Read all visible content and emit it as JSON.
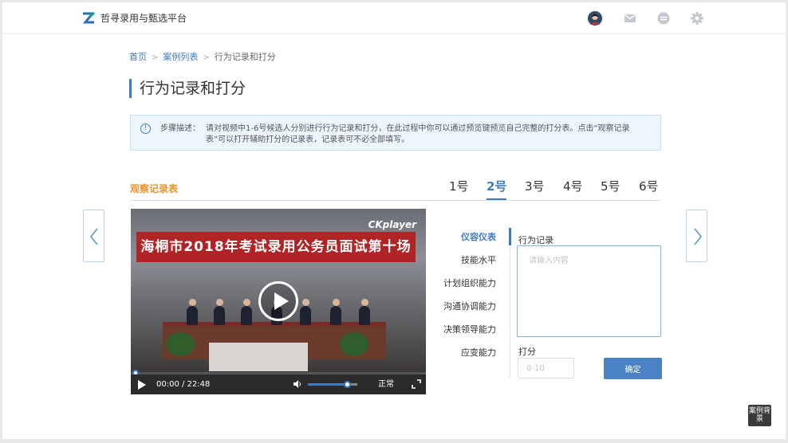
{
  "header": {
    "brand": "哲寻录用与甄选平台",
    "icons": [
      "avatar",
      "mail-icon",
      "message-icon",
      "gear-icon"
    ]
  },
  "breadcrumb": {
    "home": "首页",
    "case_list": "案例列表",
    "current": "行为记录和打分",
    "separator": ">"
  },
  "page_title": "行为记录和打分",
  "notice": {
    "label": "步骤描述：",
    "text": "请对视频中1-6号候选人分别进行行为记录和打分，在此过程中你可以通过预览键预览自己完整的打分表。点击“观察记录表”可以打开辅助打分的记录表，记录表可不必全部填写。"
  },
  "observation_link": "观察记录表",
  "candidate_tabs": [
    "1号",
    "2号",
    "3号",
    "4号",
    "5号",
    "6号"
  ],
  "active_candidate": "2号",
  "video": {
    "banner": "海桐市2018年考试录用公务员面试第十场",
    "watermark": "CKplayer",
    "time": "00:00 / 22:48",
    "speed": "正常",
    "progress": 0.0,
    "volume": 0.8
  },
  "criteria": [
    "仪容仪表",
    "技能水平",
    "计划组织能力",
    "沟通协调能力",
    "决策领导能力",
    "应变能力"
  ],
  "active_criterion": "仪容仪表",
  "record": {
    "label": "行为记录",
    "placeholder": "请输入内容"
  },
  "score": {
    "label": "打分",
    "placeholder": "0-10"
  },
  "confirm_label": "确定",
  "case_background_label": "案例背景",
  "colors": {
    "accent": "#3f7ac4",
    "orange": "#e8932e",
    "banner_red": "#b12425"
  }
}
